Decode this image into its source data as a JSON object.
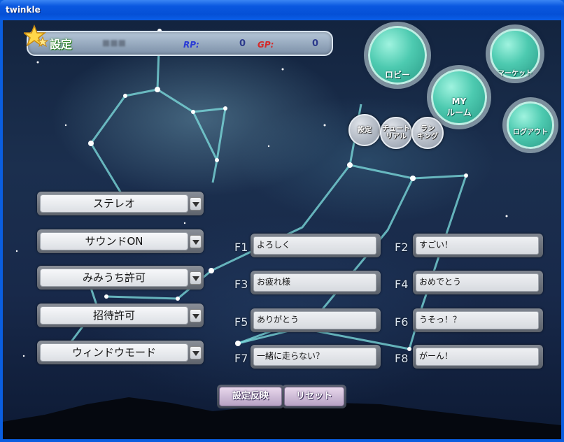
{
  "window": {
    "title": "twinkle"
  },
  "header": {
    "title": "設定",
    "player_name": "■■■",
    "rp_label": "RP:",
    "rp_value": "0",
    "gp_label": "GP:",
    "gp_value": "0"
  },
  "nav": {
    "lobby": "ロビー",
    "myroom_line1": "MY",
    "myroom_line2": "ルーム",
    "market": "マーケット",
    "logout": "ログアウト",
    "settings": "設定",
    "tutorial_line1": "チュート",
    "tutorial_line2": "リアル",
    "ranking_line1": "ラン",
    "ranking_line2": "キング"
  },
  "options": [
    {
      "value": "ステレオ"
    },
    {
      "value": "サウンドON"
    },
    {
      "value": "みみうち許可"
    },
    {
      "value": "招待許可"
    },
    {
      "value": "ウィンドウモード"
    }
  ],
  "fkeys": [
    {
      "key": "F1",
      "text": "よろしく"
    },
    {
      "key": "F2",
      "text": "すごい！"
    },
    {
      "key": "F3",
      "text": "お疲れ様"
    },
    {
      "key": "F4",
      "text": "おめでとう"
    },
    {
      "key": "F5",
      "text": "ありがとう"
    },
    {
      "key": "F6",
      "text": "うそっ！？"
    },
    {
      "key": "F7",
      "text": "一緒に走らない？"
    },
    {
      "key": "F8",
      "text": "がーん！"
    }
  ],
  "buttons": {
    "apply": "設定反映",
    "reset": "リセット"
  },
  "colors": {
    "rp_label": "#2a3bd6",
    "gp_label": "#d42a2a",
    "accent": "#4dcab0"
  }
}
